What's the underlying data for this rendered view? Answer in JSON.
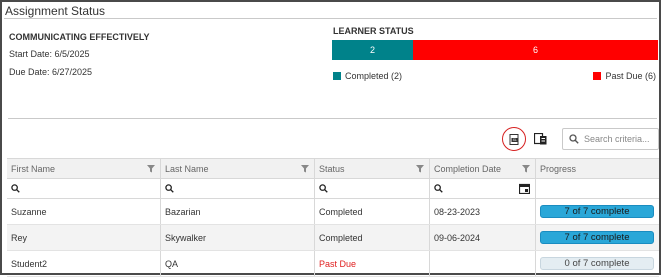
{
  "panel": {
    "title": "Assignment Status"
  },
  "course": {
    "name": "COMMUNICATING EFFECTIVELY",
    "start_date": "Start Date: 6/5/2025",
    "due_date": "Due Date: 6/27/2025"
  },
  "learner_status": {
    "title": "LEARNER STATUS",
    "completed_count": "2",
    "past_due_count": "6",
    "completed_legend": "Completed (2)",
    "past_due_legend": "Past Due (6)",
    "completed_color": "#00828a",
    "past_due_color": "#ff0000",
    "completed_fraction": 0.25
  },
  "toolbar": {
    "export_icon": "export-excel-icon",
    "columns_icon": "column-chooser-icon",
    "search_placeholder": "Search criteria..."
  },
  "table": {
    "columns": [
      "First Name",
      "Last Name",
      "Status",
      "Completion Date",
      "Progress"
    ],
    "rows": [
      {
        "first_name": "Suzanne",
        "last_name": "Bazarian",
        "status": "Completed",
        "completion_date": "08-23-2023",
        "progress": "7 of 7 complete",
        "progress_fraction": 1
      },
      {
        "first_name": "Rey",
        "last_name": "Skywalker",
        "status": "Completed",
        "completion_date": "09-06-2024",
        "progress": "7 of 7 complete",
        "progress_fraction": 1
      },
      {
        "first_name": "Student2",
        "last_name": "QA",
        "status": "Past Due",
        "completion_date": "",
        "progress": "0 of 7 complete",
        "progress_fraction": 0
      }
    ]
  }
}
